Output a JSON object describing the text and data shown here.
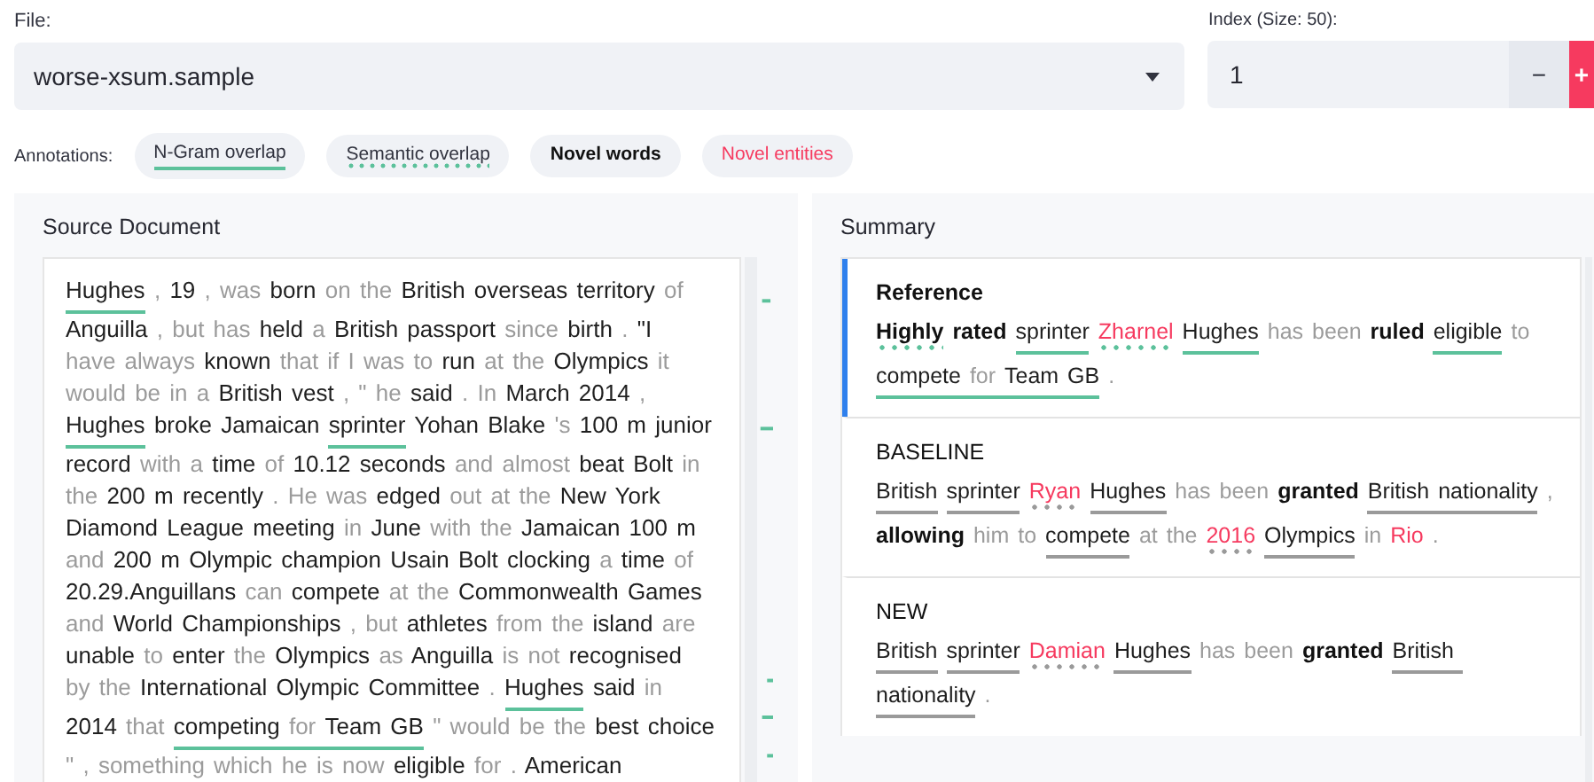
{
  "file": {
    "label": "File:",
    "value": "worse-xsum.sample"
  },
  "index": {
    "label": "Index (Size: 50):",
    "value": "1",
    "decrement": "−",
    "increment": "+"
  },
  "annotations": {
    "label": "Annotations:",
    "chips": [
      {
        "text": "N-Gram overlap",
        "kind": "ngram"
      },
      {
        "text": "Semantic overlap",
        "kind": "semantic"
      },
      {
        "text": "Novel words",
        "kind": "novel"
      },
      {
        "text": "Novel entities",
        "kind": "entity"
      }
    ]
  },
  "source": {
    "title": "Source Document",
    "segments": [
      {
        "text": "Hughes",
        "kind": "match",
        "ngram_overlap": true
      },
      {
        "text": ",",
        "kind": "plain"
      },
      {
        "text": "19",
        "kind": "match"
      },
      {
        "text": ", was",
        "kind": "plain"
      },
      {
        "text": "born",
        "kind": "match"
      },
      {
        "text": "on the",
        "kind": "plain"
      },
      {
        "text": "British overseas territory",
        "kind": "match"
      },
      {
        "text": "of",
        "kind": "plain"
      },
      {
        "text": "Anguilla",
        "kind": "match"
      },
      {
        "text": ", but has",
        "kind": "plain"
      },
      {
        "text": "held",
        "kind": "match"
      },
      {
        "text": "a",
        "kind": "plain"
      },
      {
        "text": "British passport",
        "kind": "match"
      },
      {
        "text": "since",
        "kind": "plain"
      },
      {
        "text": "birth",
        "kind": "match"
      },
      {
        "text": ".",
        "kind": "plain"
      },
      {
        "text": "\"I",
        "kind": "match"
      },
      {
        "text": "have always",
        "kind": "plain"
      },
      {
        "text": "known",
        "kind": "match"
      },
      {
        "text": "that if I was to",
        "kind": "plain"
      },
      {
        "text": "run",
        "kind": "match"
      },
      {
        "text": "at the",
        "kind": "plain"
      },
      {
        "text": "Olympics",
        "kind": "match"
      },
      {
        "text": "it",
        "kind": "plain"
      },
      {
        "text": "would be in a",
        "kind": "plain"
      },
      {
        "text": "British vest",
        "kind": "match"
      },
      {
        "text": ", \" he",
        "kind": "plain"
      },
      {
        "text": "said",
        "kind": "match"
      },
      {
        "text": ". In",
        "kind": "plain"
      },
      {
        "text": "March 2014",
        "kind": "match"
      },
      {
        "text": ",",
        "kind": "plain"
      },
      {
        "text": "Hughes",
        "kind": "match",
        "ngram_overlap": true
      },
      {
        "text": "broke Jamaican",
        "kind": "match"
      },
      {
        "text": "sprinter",
        "kind": "match",
        "ngram_overlap": true
      },
      {
        "text": "Yohan Blake",
        "kind": "match"
      },
      {
        "text": "'s",
        "kind": "plain"
      },
      {
        "text": "100 m junior",
        "kind": "match"
      },
      {
        "text": "record",
        "kind": "match"
      },
      {
        "text": "with a",
        "kind": "plain"
      },
      {
        "text": "time",
        "kind": "match"
      },
      {
        "text": "of",
        "kind": "plain"
      },
      {
        "text": "10.12 seconds",
        "kind": "match"
      },
      {
        "text": "and almost",
        "kind": "plain"
      },
      {
        "text": "beat Bolt",
        "kind": "match"
      },
      {
        "text": "in",
        "kind": "plain"
      },
      {
        "text": "the",
        "kind": "plain"
      },
      {
        "text": "200 m recently",
        "kind": "match"
      },
      {
        "text": ". He was",
        "kind": "plain"
      },
      {
        "text": "edged",
        "kind": "match"
      },
      {
        "text": "out at the",
        "kind": "plain"
      },
      {
        "text": "New York",
        "kind": "match"
      },
      {
        "text": "Diamond League meeting",
        "kind": "match"
      },
      {
        "text": "in",
        "kind": "plain"
      },
      {
        "text": "June",
        "kind": "match"
      },
      {
        "text": "with the",
        "kind": "plain"
      },
      {
        "text": "Jamaican 100 m",
        "kind": "match"
      },
      {
        "text": "and",
        "kind": "plain"
      },
      {
        "text": "200 m Olympic champion Usain Bolt clocking",
        "kind": "match"
      },
      {
        "text": "a",
        "kind": "plain"
      },
      {
        "text": "time",
        "kind": "match"
      },
      {
        "text": "of",
        "kind": "plain"
      },
      {
        "text": "20.29.Anguillans",
        "kind": "match"
      },
      {
        "text": "can",
        "kind": "plain"
      },
      {
        "text": "compete",
        "kind": "match"
      },
      {
        "text": "at the",
        "kind": "plain"
      },
      {
        "text": "Commonwealth Games",
        "kind": "match"
      },
      {
        "text": "and",
        "kind": "plain"
      },
      {
        "text": "World Championships",
        "kind": "match"
      },
      {
        "text": ", but",
        "kind": "plain"
      },
      {
        "text": "athletes",
        "kind": "match"
      },
      {
        "text": "from the",
        "kind": "plain"
      },
      {
        "text": "island",
        "kind": "match"
      },
      {
        "text": "are",
        "kind": "plain"
      },
      {
        "text": "unable",
        "kind": "match"
      },
      {
        "text": "to",
        "kind": "plain"
      },
      {
        "text": "enter",
        "kind": "match"
      },
      {
        "text": "the",
        "kind": "plain"
      },
      {
        "text": "Olympics",
        "kind": "match"
      },
      {
        "text": "as",
        "kind": "plain"
      },
      {
        "text": "Anguilla",
        "kind": "match"
      },
      {
        "text": "is not",
        "kind": "plain"
      },
      {
        "text": "recognised",
        "kind": "match"
      },
      {
        "text": "by the",
        "kind": "plain"
      },
      {
        "text": "International Olympic Committee",
        "kind": "match"
      },
      {
        "text": ".",
        "kind": "plain"
      },
      {
        "text": "Hughes",
        "kind": "match",
        "ngram_overlap": true
      },
      {
        "text": "said",
        "kind": "match"
      },
      {
        "text": "in",
        "kind": "plain"
      },
      {
        "text": "2014",
        "kind": "match"
      },
      {
        "text": "that",
        "kind": "plain"
      },
      {
        "text": "competing",
        "kind": "match",
        "ngram_overlap": true
      },
      {
        "text": "for",
        "kind": "plain",
        "ngram_overlap": true,
        "joined": true
      },
      {
        "text": "Team GB",
        "kind": "match",
        "ngram_overlap": true,
        "joined": true
      },
      {
        "text": "\" would be the",
        "kind": "plain"
      },
      {
        "text": "best",
        "kind": "match"
      },
      {
        "text": "choice",
        "kind": "match"
      },
      {
        "text": "\" , something which he is now",
        "kind": "plain"
      },
      {
        "text": "eligible",
        "kind": "match"
      },
      {
        "text": "for .",
        "kind": "plain"
      },
      {
        "text": "American",
        "kind": "match"
      }
    ]
  },
  "summary": {
    "title": "Summary",
    "items": [
      {
        "title": "Reference",
        "selected": true,
        "tokens": [
          {
            "text": "Highly",
            "kind": "novel",
            "semantic_overlap": true
          },
          {
            "text": "rated",
            "kind": "novel"
          },
          {
            "text": "sprinter",
            "kind": "match",
            "ngram_overlap": true
          },
          {
            "text": "Zharnel",
            "kind": "entity",
            "semantic_overlap": true
          },
          {
            "text": "Hughes",
            "kind": "match",
            "ngram_overlap": true
          },
          {
            "text": "has been",
            "kind": "plain"
          },
          {
            "text": "ruled",
            "kind": "novel"
          },
          {
            "text": "eligible",
            "kind": "match",
            "ngram_overlap": true
          },
          {
            "text": "to",
            "kind": "plain"
          },
          {
            "text": "compete",
            "kind": "match",
            "ngram_overlap": true
          },
          {
            "text": "for",
            "kind": "plain",
            "ngram_overlap": true,
            "joined": true
          },
          {
            "text": "Team GB",
            "kind": "match",
            "ngram_overlap": true,
            "joined": true
          },
          {
            "text": ".",
            "kind": "plain"
          }
        ]
      },
      {
        "title": "BASELINE",
        "selected": false,
        "tokens": [
          {
            "text": "British",
            "kind": "match",
            "ngram_overlap": true
          },
          {
            "text": "sprinter",
            "kind": "match",
            "ngram_overlap": true
          },
          {
            "text": "Ryan",
            "kind": "entity",
            "semantic_overlap": true
          },
          {
            "text": "Hughes",
            "kind": "match",
            "ngram_overlap": true
          },
          {
            "text": "has been",
            "kind": "plain"
          },
          {
            "text": "granted",
            "kind": "novel"
          },
          {
            "text": "British nationality",
            "kind": "match",
            "ngram_overlap": true
          },
          {
            "text": ",",
            "kind": "plain"
          },
          {
            "text": "allowing",
            "kind": "novel"
          },
          {
            "text": "him to",
            "kind": "plain"
          },
          {
            "text": "compete",
            "kind": "match",
            "ngram_overlap": true
          },
          {
            "text": "at the",
            "kind": "plain"
          },
          {
            "text": "2016",
            "kind": "entity",
            "semantic_overlap": true
          },
          {
            "text": "Olympics",
            "kind": "match",
            "ngram_overlap": true
          },
          {
            "text": "in",
            "kind": "plain"
          },
          {
            "text": "Rio",
            "kind": "entity"
          },
          {
            "text": ".",
            "kind": "plain"
          }
        ]
      },
      {
        "title": "NEW",
        "selected": false,
        "tokens": [
          {
            "text": "British",
            "kind": "match",
            "ngram_overlap": true
          },
          {
            "text": "sprinter",
            "kind": "match",
            "ngram_overlap": true
          },
          {
            "text": "Damian",
            "kind": "entity",
            "semantic_overlap": true
          },
          {
            "text": "Hughes",
            "kind": "match",
            "ngram_overlap": true
          },
          {
            "text": "has been",
            "kind": "plain"
          },
          {
            "text": "granted",
            "kind": "novel"
          },
          {
            "text": "British",
            "kind": "match",
            "ngram_overlap": true
          },
          {
            "text": "nationality",
            "kind": "match",
            "ngram_overlap": true,
            "joined": true
          },
          {
            "text": ".",
            "kind": "plain"
          }
        ]
      }
    ]
  }
}
